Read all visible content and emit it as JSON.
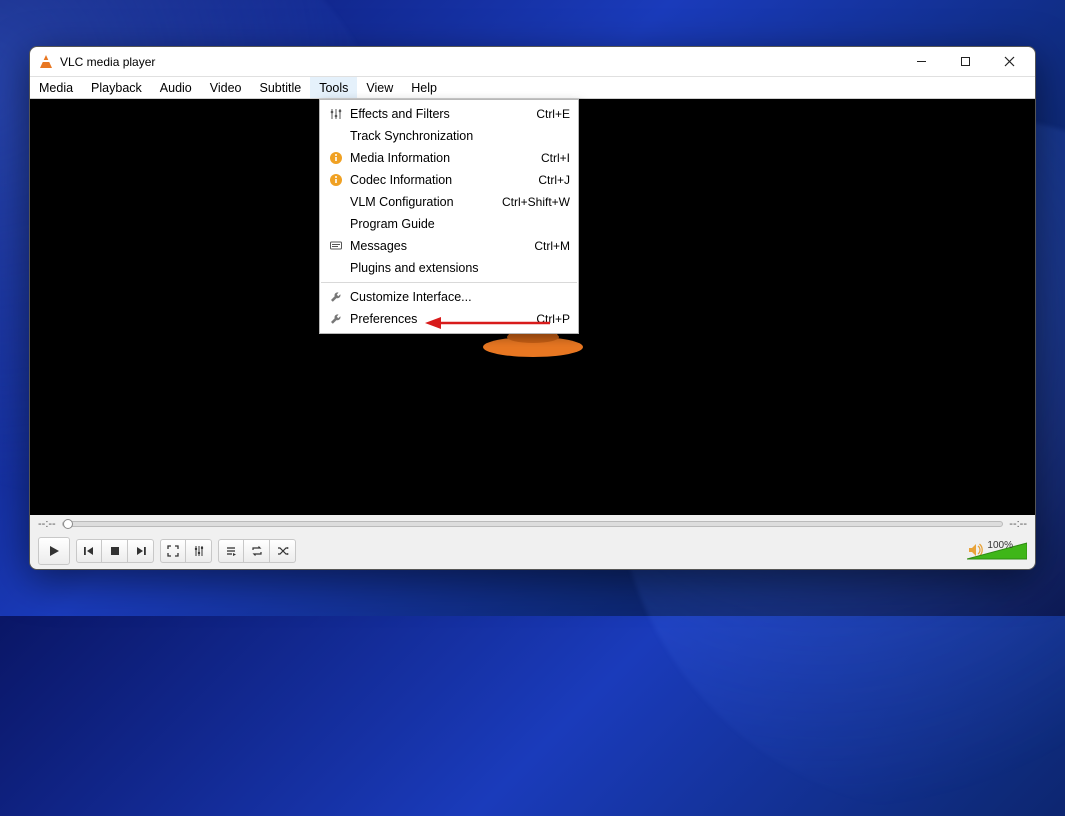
{
  "window": {
    "title": "VLC media player"
  },
  "menubar": {
    "items": [
      "Media",
      "Playback",
      "Audio",
      "Video",
      "Subtitle",
      "Tools",
      "View",
      "Help"
    ],
    "open_index": 5
  },
  "tools_menu": {
    "items": [
      {
        "icon": "sliders",
        "label": "Effects and Filters",
        "shortcut": "Ctrl+E"
      },
      {
        "icon": "",
        "label": "Track Synchronization",
        "shortcut": ""
      },
      {
        "icon": "info",
        "label": "Media Information",
        "shortcut": "Ctrl+I"
      },
      {
        "icon": "info",
        "label": "Codec Information",
        "shortcut": "Ctrl+J"
      },
      {
        "icon": "",
        "label": "VLM Configuration",
        "shortcut": "Ctrl+Shift+W"
      },
      {
        "icon": "",
        "label": "Program Guide",
        "shortcut": ""
      },
      {
        "icon": "message",
        "label": "Messages",
        "shortcut": "Ctrl+M"
      },
      {
        "icon": "",
        "label": "Plugins and extensions",
        "shortcut": ""
      },
      {
        "sep": true
      },
      {
        "icon": "wrench",
        "label": "Customize Interface...",
        "shortcut": ""
      },
      {
        "icon": "wrench",
        "label": "Preferences",
        "shortcut": "Ctrl+P"
      }
    ]
  },
  "seek": {
    "elapsed": "--:--",
    "total": "--:--"
  },
  "volume": {
    "percent_label": "100%"
  }
}
